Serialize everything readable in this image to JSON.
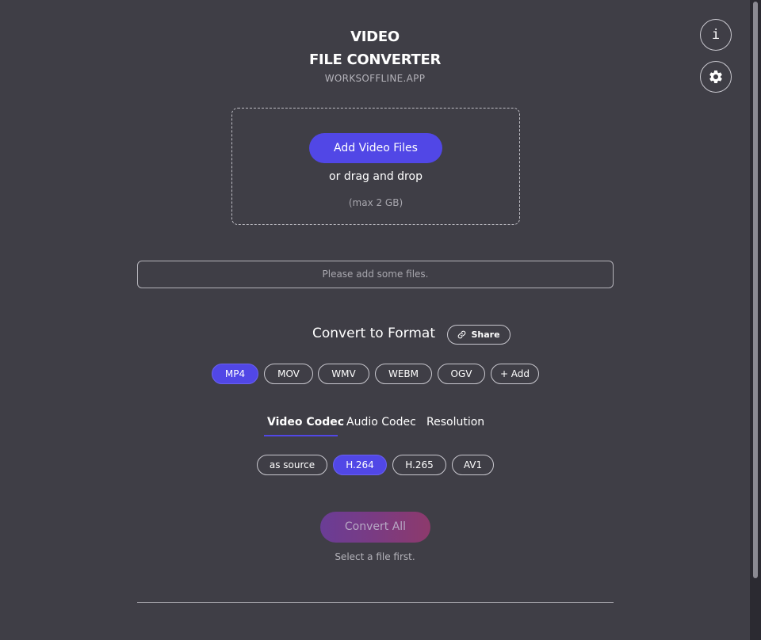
{
  "header": {
    "title_line1": "VIDEO",
    "title_line2": "FILE CONVERTER",
    "subtitle": "WORKSOFFLINE.APP"
  },
  "top_right": {
    "info_icon": "info-icon",
    "settings_icon": "gear-icon"
  },
  "dropzone": {
    "add_button_label": "Add Video Files",
    "drag_text": "or drag and drop",
    "max_text": "(max 2 GB)"
  },
  "file_list": {
    "empty_text": "Please add some files."
  },
  "format": {
    "title": "Convert to Format",
    "share_label": "Share",
    "share_icon": "link-icon",
    "options": [
      "MP4",
      "MOV",
      "WMV",
      "WEBM",
      "OGV",
      "+ Add"
    ],
    "selected": "MP4"
  },
  "settings_tabs": {
    "tabs": [
      "Video Codec",
      "Audio Codec",
      "Resolution"
    ],
    "active": "Video Codec"
  },
  "video_codec": {
    "options": [
      "as source",
      "H.264",
      "H.265",
      "AV1"
    ],
    "selected": "H.264"
  },
  "convert": {
    "button_label": "Convert All",
    "hint": "Select a file first."
  },
  "colors": {
    "background": "#3f3e46",
    "accent": "#5147e6"
  }
}
